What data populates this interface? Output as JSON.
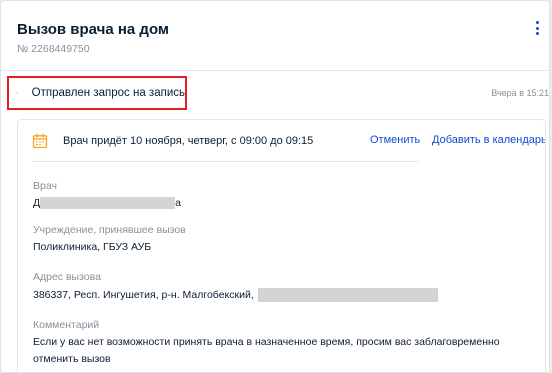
{
  "header": {
    "title": "Вызов врача на дом",
    "number": "№ 2268449750",
    "menu_icon": "kebab-menu-icon"
  },
  "status": {
    "icon": "clock-icon",
    "text": "Отправлен запрос на запись",
    "time": "Вчера в 15:21",
    "colors": {
      "icon": "#f5a623",
      "highlight_border": "#e31e24"
    }
  },
  "appointment": {
    "icon": "calendar-icon",
    "text": "Врач придёт 10 ноября, четверг, с 09:00 до 09:15",
    "cancel_label": "Отменить",
    "add_calendar_label": "Добавить в календарь",
    "colors": {
      "link": "#0d4cd3",
      "icon": "#f5a623"
    }
  },
  "details": {
    "doctor": {
      "label": "Врач",
      "value_start": "Д",
      "value_end": "а"
    },
    "organization": {
      "label": "Учреждение, принявшее вызов",
      "value": "Поликлиника, ГБУЗ АУБ"
    },
    "address": {
      "label": "Адрес вызова",
      "value": "386337, Респ. Ингушетия, р-н. Малгобекский,"
    },
    "comment": {
      "label": "Комментарий",
      "value": "Если у вас нет возможности принять врача в назначенное время, просим вас заблаговременно отменить вызов"
    }
  }
}
